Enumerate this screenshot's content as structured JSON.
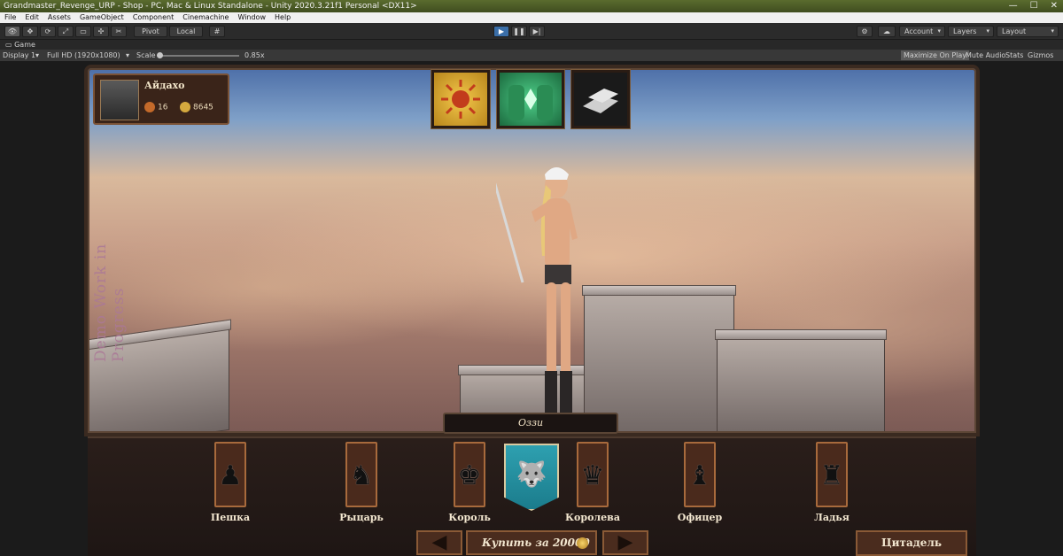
{
  "window": {
    "title": "Grandmaster_Revenge_URP - Shop - PC, Mac & Linux Standalone - Unity 2020.3.21f1 Personal <DX11>"
  },
  "menu": [
    "File",
    "Edit",
    "Assets",
    "GameObject",
    "Component",
    "Cinemachine",
    "Window",
    "Help"
  ],
  "toolbar": {
    "pivot_label": "Pivot",
    "local_label": "Local",
    "account_label": "Account",
    "layers_label": "Layers",
    "layout_label": "Layout"
  },
  "tab": {
    "label": "Game"
  },
  "gamebar": {
    "display": "Display 1",
    "resolution": "Full HD (1920x1080)",
    "scale_label": "Scale",
    "scale_value": "0.85x",
    "maximize": "Maximize On Play",
    "mute": "Mute Audio",
    "stats": "Stats",
    "gizmos": "Gizmos"
  },
  "game": {
    "player": {
      "name": "Айдахо",
      "level": "16",
      "gold": "8645"
    },
    "watermark": "Demo Work in Progress",
    "character_name": "Оззи",
    "pieces": [
      {
        "label": "Пешка",
        "glyph": "♟"
      },
      {
        "label": "Рыцарь",
        "glyph": "♞"
      },
      {
        "label": "Король",
        "glyph": "♚"
      },
      {
        "label": "Королева",
        "glyph": "♛"
      },
      {
        "label": "Офицер",
        "glyph": "♝"
      },
      {
        "label": "Ладья",
        "glyph": "♜"
      }
    ],
    "prev_glyph": "◀",
    "next_glyph": "▶",
    "buy_label": "Купить за 20000",
    "citadel_label": "Цитадель"
  },
  "colors": {
    "accent": "#3a6ea8",
    "panel_wood": "#4a2c1e",
    "banner_teal": "#1b7c8c"
  }
}
